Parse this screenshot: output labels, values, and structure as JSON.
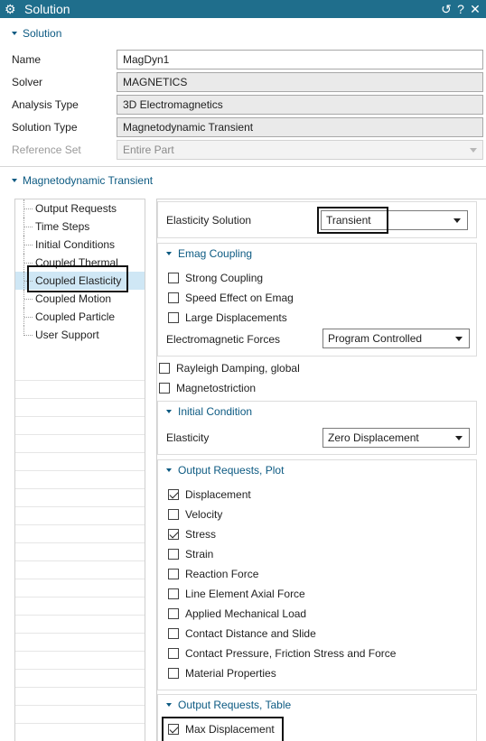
{
  "window": {
    "title": "Solution",
    "buttons": {
      "reset": "↺",
      "help": "?",
      "close": "✕"
    }
  },
  "solution_section": {
    "header": "Solution",
    "rows": [
      {
        "label": "Name",
        "value": "MagDyn1"
      },
      {
        "label": "Solver",
        "value": "MAGNETICS"
      },
      {
        "label": "Analysis Type",
        "value": "3D Electromagnetics"
      },
      {
        "label": "Solution Type",
        "value": "Magnetodynamic Transient"
      },
      {
        "label": "Reference Set",
        "value": "Entire Part"
      }
    ]
  },
  "transient_section": {
    "header": "Magnetodynamic Transient"
  },
  "tree": {
    "items": [
      {
        "label": "Output Requests"
      },
      {
        "label": "Time Steps"
      },
      {
        "label": "Initial Conditions"
      },
      {
        "label": "Coupled Thermal"
      },
      {
        "label": "Coupled Elasticity",
        "selected": true
      },
      {
        "label": "Coupled Motion"
      },
      {
        "label": "Coupled Particle"
      },
      {
        "label": "User Support"
      }
    ]
  },
  "elasticity": {
    "label": "Elasticity Solution",
    "value": "Transient"
  },
  "emag_coupling": {
    "header": "Emag Coupling",
    "options": [
      {
        "label": "Strong Coupling",
        "checked": false
      },
      {
        "label": "Speed Effect on Emag",
        "checked": false
      },
      {
        "label": "Large Displacements",
        "checked": false
      }
    ],
    "forces_label": "Electromagnetic Forces",
    "forces_value": "Program Controlled"
  },
  "global_options": [
    {
      "label": "Rayleigh Damping, global",
      "checked": false
    },
    {
      "label": "Magnetostriction",
      "checked": false
    }
  ],
  "initial_condition": {
    "header": "Initial Condition",
    "label": "Elasticity",
    "value": "Zero Displacement"
  },
  "output_plot": {
    "header": "Output Requests, Plot",
    "items": [
      {
        "label": "Displacement",
        "checked": true
      },
      {
        "label": "Velocity",
        "checked": false
      },
      {
        "label": "Stress",
        "checked": true
      },
      {
        "label": "Strain",
        "checked": false
      },
      {
        "label": "Reaction Force",
        "checked": false
      },
      {
        "label": "Line Element Axial Force",
        "checked": false
      },
      {
        "label": "Applied Mechanical Load",
        "checked": false
      },
      {
        "label": "Contact Distance and Slide",
        "checked": false
      },
      {
        "label": "Contact Pressure, Friction Stress and Force",
        "checked": false
      },
      {
        "label": "Material Properties",
        "checked": false
      }
    ]
  },
  "output_table": {
    "header": "Output Requests, Table",
    "items": [
      {
        "label": "Max Displacement",
        "checked": true
      }
    ]
  },
  "icons": {
    "title": "gear-icon",
    "section_toggle": "caret-down-icon",
    "dropdown": "chevron-down-icon"
  },
  "colors": {
    "titlebar": "#1f6e8c",
    "section_header": "#0c5a82",
    "selection": "#cfe7f5"
  }
}
